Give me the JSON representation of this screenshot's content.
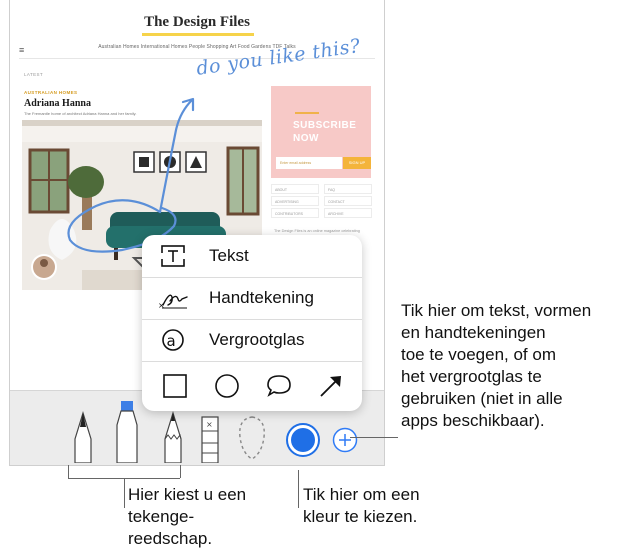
{
  "website": {
    "title": "The Design Files",
    "menu_glyph": "≡",
    "nav": "Australian Homes   International Homes   People   Shopping   Art   Food   Gardens   TDF Talks",
    "section_label": "LATEST",
    "kicker": "AUSTRALIAN HOMES",
    "author": "Adriana Hanna",
    "excerpt": "The Fremantle home of architect Adriana Hanna and her family.",
    "subscribe_text": "SUBSCRIBE NOW",
    "subscribe_placeholder": "Enter email address",
    "subscribe_button": "SIGN UP",
    "side_nav": [
      "ABOUT",
      "FAQ",
      "ADVERTISING",
      "CONTACT",
      "CONTRIBUTORS",
      "ARCHIVE"
    ],
    "side_text": "The Design Files is an online magazine celebrating Australian design and creativity."
  },
  "annotation": {
    "handwriting": "do you like this?",
    "ink_color": "#5b8fd8"
  },
  "popup_menu": {
    "items": [
      {
        "label": "Tekst",
        "icon": "text-box-icon"
      },
      {
        "label": "Handtekening",
        "icon": "signature-icon"
      },
      {
        "label": "Vergrootglas",
        "icon": "magnifier-icon"
      }
    ],
    "shapes": [
      "square-shape-icon",
      "circle-shape-icon",
      "speech-bubble-icon",
      "arrow-icon"
    ]
  },
  "toolbar": {
    "tools": [
      "pen-tool",
      "marker-tool",
      "pencil-tool",
      "eraser-tool",
      "lasso-tool",
      "color-picker",
      "add-button"
    ],
    "selected_color": "#1f6fe6",
    "accent": "#2f7bf6"
  },
  "callouts": {
    "right": "Tik hier om tekst, vormen en handtekeningen toe te voegen, of om het vergrootglas te gebruiken (niet in alle apps beschikbaar).",
    "right_lines": [
      "Tik hier om tekst, vormen",
      "en handtekeningen",
      "toe te voegen, of om",
      "het vergrootglas te",
      "gebruiken (niet in alle",
      "apps beschikbaar)."
    ],
    "tools_lines": [
      "Hier kiest u een",
      "tekenge-",
      "reedschap."
    ],
    "color_lines": [
      "Tik hier om een",
      "kleur te kiezen."
    ]
  }
}
